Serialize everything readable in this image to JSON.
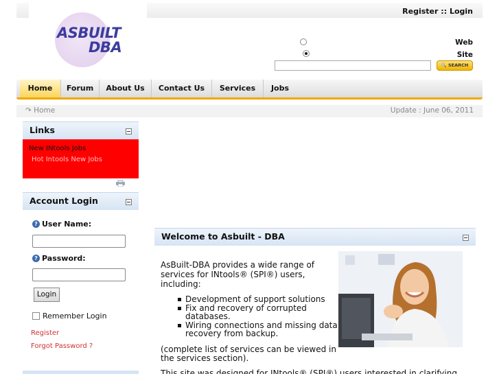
{
  "header": {
    "register": "Register",
    "separator": "::",
    "login": "Login",
    "logo_line1": "ASBUILT",
    "logo_line2": "DBA"
  },
  "search": {
    "option_web": "Web",
    "option_site": "Site",
    "selected": "Site",
    "value": "",
    "button_label": "SEARCH"
  },
  "nav": {
    "items": [
      "Home",
      "Forum",
      "About Us",
      "Contact Us",
      "Services",
      "Jobs"
    ],
    "active": "Home"
  },
  "breadcrumb": {
    "current": "Home",
    "update": "Update : June 06, 2011"
  },
  "links_panel": {
    "title": "Links",
    "items": [
      "New INtools Jobs",
      "Hot Intools New Jobs"
    ]
  },
  "login_panel": {
    "title": "Account Login",
    "username_label": "User Name:",
    "password_label": "Password:",
    "username_value": "",
    "password_value": "",
    "login_button": "Login",
    "remember_label": "Remember Login",
    "register_link": "Register",
    "forgot_link": "Forgot Password ?"
  },
  "welcome": {
    "title": "Welcome to Asbuilt - DBA",
    "intro": [
      "AsBuilt-DBA provides a wide range of",
      "services for INtools® (SPI®) users,",
      "including:"
    ],
    "bullets": [
      [
        "Development of support solutions"
      ],
      [
        "Fix and recovery of corrupted",
        "databases."
      ],
      [
        "Wiring connections and missing data",
        "recovery from backup."
      ]
    ],
    "note": [
      "(complete list of services can be viewed in",
      "the services section)."
    ],
    "cut_line": "This site was designed for INtools® (SPI®) users interested in clarifying"
  },
  "colors": {
    "accent": "#f0a800",
    "logo": "#3b3d9c",
    "links_box": "#ff0000",
    "panel_head": "#d6e4f3"
  }
}
